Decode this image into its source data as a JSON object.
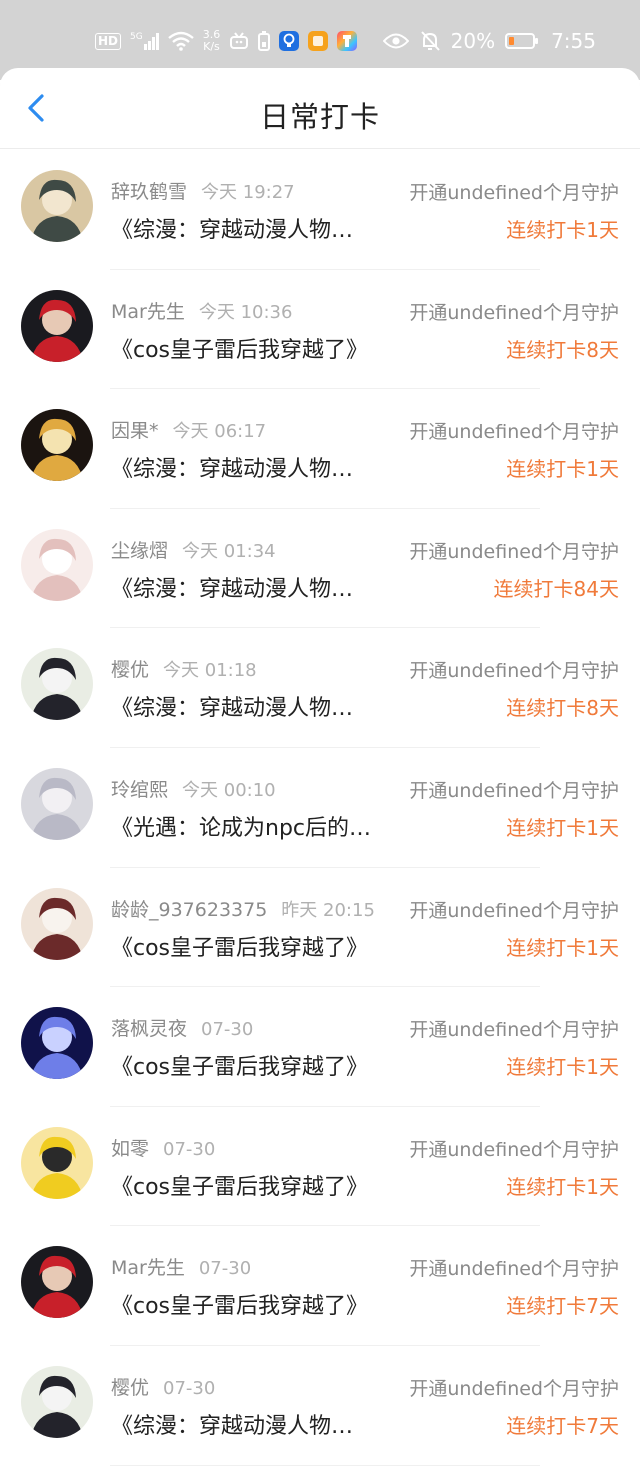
{
  "status_bar": {
    "hd": "HD",
    "signal": "5G",
    "net_speed": "3.6",
    "net_unit": "K/s",
    "battery_text": "20%",
    "time": "7:55",
    "icons": [
      "signal-icon",
      "wifi-icon",
      "tv-icon",
      "battery-saver-icon",
      "bulb-app-icon",
      "orange-app-icon",
      "colorful-app-icon",
      "eye-icon",
      "mute-bell-icon",
      "battery-icon"
    ],
    "colors": {
      "battery_low": "#ff8a30"
    }
  },
  "header": {
    "title": "日常打卡",
    "back_icon": "chevron-left-icon",
    "accent": "#2d8cf0"
  },
  "list": [
    {
      "name": "辞玖鹤雪",
      "time": "今天 19:27",
      "action": "开通undefined个月守护",
      "book": "《综漫：穿越动漫人物…",
      "streak": "连续打卡1天",
      "avatar_colors": [
        "#d9c7a3",
        "#3f4a45",
        "#f2e6cf"
      ]
    },
    {
      "name": "Mar先生",
      "time": "今天 10:36",
      "action": "开通undefined个月守护",
      "book": "《cos皇子雷后我穿越了》",
      "streak": "连续打卡8天",
      "avatar_colors": [
        "#1a1a1f",
        "#c8202a",
        "#e7c9b5"
      ]
    },
    {
      "name": "因果*",
      "time": "今天 06:17",
      "action": "开通undefined个月守护",
      "book": "《综漫：穿越动漫人物…",
      "streak": "连续打卡1天",
      "avatar_colors": [
        "#1b1410",
        "#e0a940",
        "#f4e3b0"
      ]
    },
    {
      "name": "尘缘熠",
      "time": "今天 01:34",
      "action": "开通undefined个月守护",
      "book": "《综漫：穿越动漫人物…",
      "streak": "连续打卡84天",
      "avatar_colors": [
        "#f7ecea",
        "#e3c0bd",
        "#ffffff"
      ]
    },
    {
      "name": "樱优",
      "time": "今天 01:18",
      "action": "开通undefined个月守护",
      "book": "《综漫：穿越动漫人物…",
      "streak": "连续打卡8天",
      "avatar_colors": [
        "#e9ede4",
        "#23232b",
        "#f4f4f4"
      ]
    },
    {
      "name": "玲绾熙",
      "time": "今天 00:10",
      "action": "开通undefined个月守护",
      "book": "《光遇：论成为npc后的…",
      "streak": "连续打卡1天",
      "avatar_colors": [
        "#d8d8de",
        "#b9b9c6",
        "#f2f0f3"
      ]
    },
    {
      "name": "龄龄_937623375",
      "time": "昨天 20:15",
      "action": "开通undefined个月守护",
      "book": "《cos皇子雷后我穿越了》",
      "streak": "连续打卡1天",
      "avatar_colors": [
        "#efe3d8",
        "#6b2a2a",
        "#f8f3ee"
      ]
    },
    {
      "name": "落枫灵夜",
      "time": "07-30",
      "action": "开通undefined个月守护",
      "book": "《cos皇子雷后我穿越了》",
      "streak": "连续打卡1天",
      "avatar_colors": [
        "#10124a",
        "#6e7ee8",
        "#c9d1ff"
      ]
    },
    {
      "name": "如零",
      "time": "07-30",
      "action": "开通undefined个月守护",
      "book": "《cos皇子雷后我穿越了》",
      "streak": "连续打卡1天",
      "avatar_colors": [
        "#f8e5a0",
        "#f0cc20",
        "#2a2a2a"
      ]
    },
    {
      "name": "Mar先生",
      "time": "07-30",
      "action": "开通undefined个月守护",
      "book": "《cos皇子雷后我穿越了》",
      "streak": "连续打卡7天",
      "avatar_colors": [
        "#1a1a1f",
        "#c8202a",
        "#e7c9b5"
      ]
    },
    {
      "name": "樱优",
      "time": "07-30",
      "action": "开通undefined个月守护",
      "book": "《综漫：穿越动漫人物…",
      "streak": "连续打卡7天",
      "avatar_colors": [
        "#e9ede4",
        "#23232b",
        "#f4f4f4"
      ]
    }
  ]
}
